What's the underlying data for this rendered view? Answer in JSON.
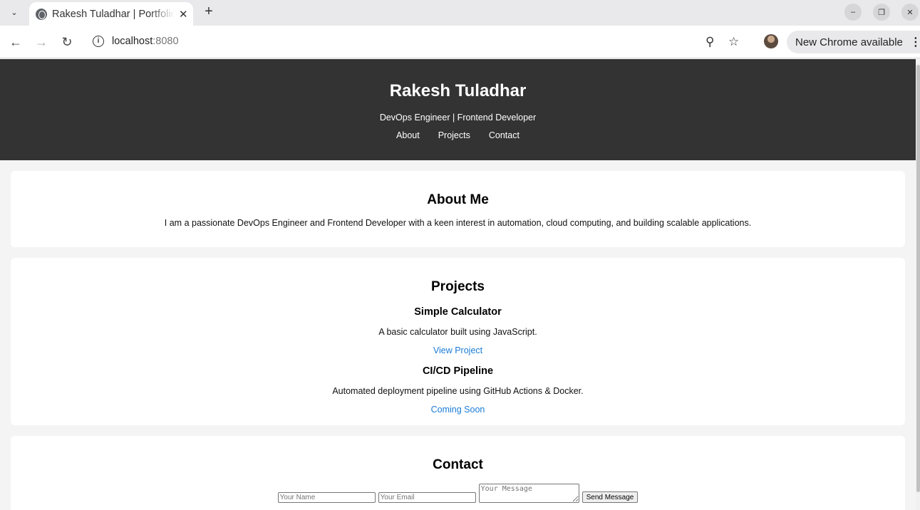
{
  "browser": {
    "tab_title": "Rakesh Tuladhar | Portfolio",
    "url_host": "localhost",
    "url_port": ":8080",
    "update_label": "New Chrome available"
  },
  "header": {
    "name": "Rakesh Tuladhar",
    "tagline": "DevOps Engineer | Frontend Developer",
    "nav": [
      "About",
      "Projects",
      "Contact"
    ]
  },
  "about": {
    "heading": "About Me",
    "text": "I am a passionate DevOps Engineer and Frontend Developer with a keen interest in automation, cloud computing, and building scalable applications."
  },
  "projects": {
    "heading": "Projects",
    "items": [
      {
        "name": "Simple Calculator",
        "description": "A basic calculator built using JavaScript.",
        "link": "View Project"
      },
      {
        "name": "CI/CD Pipeline",
        "description": "Automated deployment pipeline using GitHub Actions & Docker.",
        "link": "Coming Soon"
      }
    ]
  },
  "contact": {
    "heading": "Contact",
    "name_placeholder": "Your Name",
    "email_placeholder": "Your Email",
    "message_placeholder": "Your Message",
    "submit_label": "Send Message"
  }
}
